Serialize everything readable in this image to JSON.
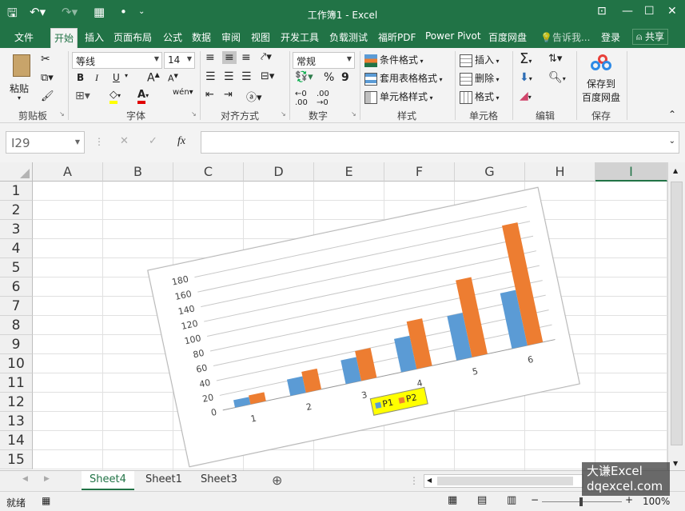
{
  "window": {
    "title": "工作簿1 - Excel"
  },
  "tabs": [
    "文件",
    "开始",
    "插入",
    "页面布局",
    "公式",
    "数据",
    "审阅",
    "视图",
    "开发工具",
    "负载测试",
    "福昕PDF",
    "Power Pivot",
    "百度网盘"
  ],
  "tell_me": "告诉我...",
  "login": "登录",
  "share": "共享",
  "ribbon": {
    "clipboard": {
      "paste": "粘贴",
      "label": "剪贴板"
    },
    "font": {
      "name": "等线",
      "size": "14",
      "bold": "B",
      "italic": "I",
      "underline": "U",
      "grow": "A",
      "shrink": "A",
      "label": "字体"
    },
    "alignment": {
      "label": "对齐方式"
    },
    "number": {
      "format": "常规",
      "percent": "%",
      "comma": "9",
      "label": "数字"
    },
    "styles": {
      "conditional": "条件格式",
      "table": "套用表格格式",
      "cell": "单元格样式",
      "label": "样式"
    },
    "cells": {
      "insert": "插入",
      "delete": "删除",
      "format": "格式",
      "label": "单元格"
    },
    "editing": {
      "label": "编辑"
    },
    "save": {
      "btn": "保存到",
      "btn2": "百度网盘",
      "label": "保存"
    }
  },
  "namebox": "I29",
  "columns": [
    "A",
    "B",
    "C",
    "D",
    "E",
    "F",
    "G",
    "H",
    "I"
  ],
  "rows": [
    "1",
    "2",
    "3",
    "4",
    "5",
    "6",
    "7",
    "8",
    "9",
    "10",
    "11",
    "12",
    "13",
    "14",
    "15"
  ],
  "sheets": [
    "Sheet4",
    "Sheet1",
    "Sheet3"
  ],
  "status": {
    "ready": "就绪",
    "zoom": "100%"
  },
  "watermark": {
    "line1": "大谦Excel",
    "line2": "dqexcel.com"
  },
  "colors": {
    "accent": "#217346",
    "p1": "#5b9bd5",
    "p2": "#ed7d31",
    "legend_bg": "#ffff00"
  },
  "chart_data": {
    "type": "bar",
    "categories": [
      "1",
      "2",
      "3",
      "4",
      "5",
      "6"
    ],
    "series": [
      {
        "name": "P1",
        "values": [
          10,
          22,
          32,
          45,
          60,
          75
        ]
      },
      {
        "name": "P2",
        "values": [
          12,
          28,
          40,
          64,
          104,
          162
        ]
      }
    ],
    "ylim": [
      0,
      180
    ],
    "yticks": [
      "0",
      "20",
      "40",
      "60",
      "80",
      "100",
      "120",
      "140",
      "160",
      "180"
    ],
    "grid": true,
    "legend": "bottom"
  }
}
